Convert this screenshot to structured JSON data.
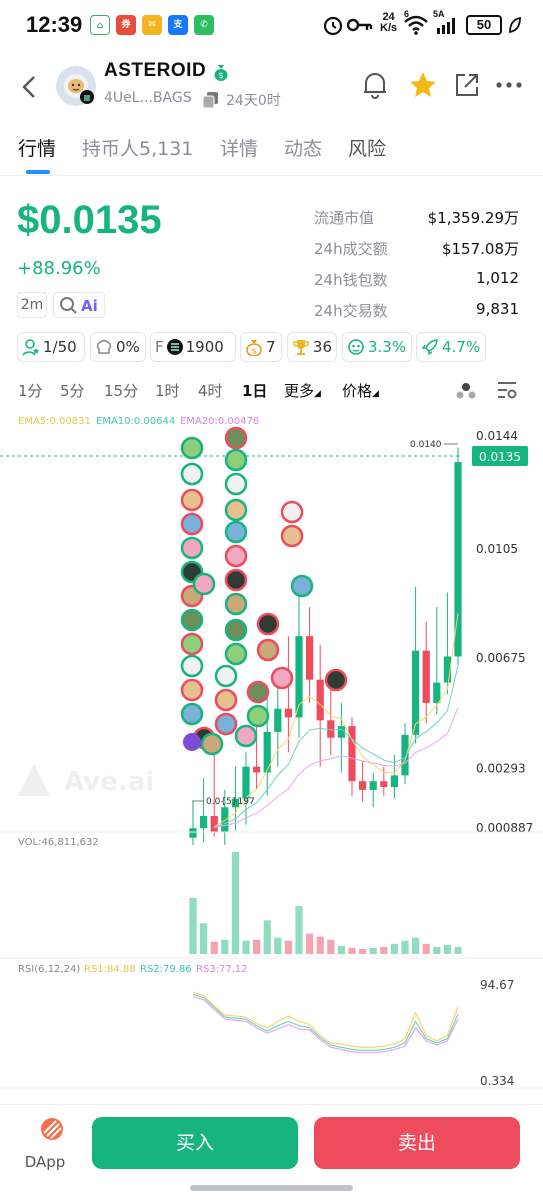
{
  "status_bar": {
    "time": "12:39",
    "net_speed_top": "24",
    "net_speed_unit": "K/s",
    "wifi_label": "6",
    "signal_label": "5A",
    "battery": "50"
  },
  "header": {
    "token_name": "ASTEROID",
    "address": "4UeL...BAGS",
    "age": "24天0时"
  },
  "tabs": [
    {
      "label": "行情"
    },
    {
      "label": "持币人5,131"
    },
    {
      "label": "详情"
    },
    {
      "label": "动态"
    },
    {
      "label": "风险"
    }
  ],
  "price": {
    "value": "$0.0135",
    "change": "+88.96%",
    "interval_badge": "2m"
  },
  "stats": [
    {
      "label": "流通市值",
      "value": "$1,359.29万"
    },
    {
      "label": "24h成交额",
      "value": "$157.08万"
    },
    {
      "label": "24h钱包数",
      "value": "1,012"
    },
    {
      "label": "24h交易数",
      "value": "9,831"
    }
  ],
  "chips": {
    "holders": "1/50",
    "dev": "0%",
    "f_label": "F",
    "f_value": "1900",
    "bag": "7",
    "trophy": "36",
    "smart": "3.3%",
    "rocket": "4.7%"
  },
  "timeframes": [
    {
      "label": "1分"
    },
    {
      "label": "5分"
    },
    {
      "label": "15分"
    },
    {
      "label": "1时"
    },
    {
      "label": "4时"
    },
    {
      "label": "1日"
    },
    {
      "label": "更多"
    },
    {
      "label": "价格"
    }
  ],
  "indicators": {
    "ema5": "EMA5:0.00831",
    "ema10": "EMA10:0.00644",
    "ema20": "EMA20:0.00478",
    "vol": "VOL:46,811,632",
    "rsi_label": "RSI(6,12,24)",
    "rsi1": "RS1:84.88",
    "rsi2": "RS2:79.86",
    "rsi3": "RS3:77.12"
  },
  "chart_data": {
    "type": "candlestick",
    "price_axis": [
      "0.0144",
      "0.0105",
      "0.00675",
      "0.00293",
      "0.000887"
    ],
    "current_price_tag": "0.0135",
    "high_label": "0.0140",
    "low_label": "0.0{5}197",
    "watermark": "Ave.ai",
    "rsi_axis": [
      "94.67",
      "0.334"
    ],
    "colors": {
      "up": "#16b47e",
      "down": "#ee4b5d",
      "ema5": "#f5d76e",
      "ema10": "#6fd3c0",
      "ema20": "#e9a6f0"
    },
    "candles": [
      {
        "o": 0.00055,
        "h": 0.0018,
        "l": 0.0003,
        "c": 0.00088
      },
      {
        "o": 0.00088,
        "h": 0.0026,
        "l": 0.0004,
        "c": 0.0013
      },
      {
        "o": 0.0013,
        "h": 0.004,
        "l": 0.0006,
        "c": 0.00075
      },
      {
        "o": 0.00075,
        "h": 0.0022,
        "l": 0.0003,
        "c": 0.0016
      },
      {
        "o": 0.0016,
        "h": 0.003,
        "l": 0.0008,
        "c": 0.0019
      },
      {
        "o": 0.0019,
        "h": 0.0035,
        "l": 0.001,
        "c": 0.003
      },
      {
        "o": 0.003,
        "h": 0.0045,
        "l": 0.0022,
        "c": 0.0028
      },
      {
        "o": 0.0028,
        "h": 0.0055,
        "l": 0.002,
        "c": 0.0042
      },
      {
        "o": 0.0042,
        "h": 0.006,
        "l": 0.003,
        "c": 0.005
      },
      {
        "o": 0.005,
        "h": 0.0075,
        "l": 0.0035,
        "c": 0.0047
      },
      {
        "o": 0.0047,
        "h": 0.0092,
        "l": 0.004,
        "c": 0.0075
      },
      {
        "o": 0.0075,
        "h": 0.0085,
        "l": 0.0052,
        "c": 0.006
      },
      {
        "o": 0.006,
        "h": 0.0072,
        "l": 0.003,
        "c": 0.0046
      },
      {
        "o": 0.0046,
        "h": 0.0058,
        "l": 0.0034,
        "c": 0.004
      },
      {
        "o": 0.004,
        "h": 0.0052,
        "l": 0.0028,
        "c": 0.0044
      },
      {
        "o": 0.0044,
        "h": 0.0047,
        "l": 0.002,
        "c": 0.0025
      },
      {
        "o": 0.0025,
        "h": 0.0032,
        "l": 0.0018,
        "c": 0.0022
      },
      {
        "o": 0.0022,
        "h": 0.0028,
        "l": 0.0016,
        "c": 0.0025
      },
      {
        "o": 0.0025,
        "h": 0.003,
        "l": 0.002,
        "c": 0.0023
      },
      {
        "o": 0.0023,
        "h": 0.0034,
        "l": 0.0019,
        "c": 0.0027
      },
      {
        "o": 0.0027,
        "h": 0.0045,
        "l": 0.0024,
        "c": 0.0041
      },
      {
        "o": 0.0041,
        "h": 0.0092,
        "l": 0.0038,
        "c": 0.007
      },
      {
        "o": 0.007,
        "h": 0.008,
        "l": 0.0045,
        "c": 0.0052
      },
      {
        "o": 0.0052,
        "h": 0.0085,
        "l": 0.0048,
        "c": 0.0059
      },
      {
        "o": 0.0059,
        "h": 0.009,
        "l": 0.0055,
        "c": 0.0068
      },
      {
        "o": 0.0068,
        "h": 0.014,
        "l": 0.0065,
        "c": 0.0135
      }
    ],
    "volume": [
      0.55,
      0.3,
      0.12,
      0.14,
      1.0,
      0.13,
      0.14,
      0.33,
      0.16,
      0.13,
      0.47,
      0.2,
      0.17,
      0.14,
      0.08,
      0.06,
      0.05,
      0.06,
      0.07,
      0.1,
      0.13,
      0.16,
      0.1,
      0.07,
      0.09,
      0.07
    ],
    "rsi1": [
      85,
      82,
      72,
      64,
      63,
      62,
      56,
      52,
      58,
      63,
      58,
      55,
      45,
      38,
      37,
      35,
      34,
      34,
      35,
      37,
      42,
      66,
      45,
      40,
      45,
      72
    ],
    "rsi2": [
      83,
      80,
      71,
      62,
      61,
      60,
      54,
      49,
      54,
      58,
      54,
      52,
      43,
      36,
      34,
      32,
      31,
      31,
      32,
      34,
      38,
      58,
      42,
      38,
      42,
      65
    ],
    "rsi3": [
      81,
      78,
      69,
      60,
      59,
      58,
      52,
      47,
      51,
      55,
      51,
      50,
      41,
      34,
      32,
      30,
      29,
      29,
      30,
      32,
      35,
      52,
      40,
      36,
      40,
      60
    ]
  },
  "bottom": {
    "dapp_label": "DApp",
    "buy": "买入",
    "sell": "卖出"
  }
}
